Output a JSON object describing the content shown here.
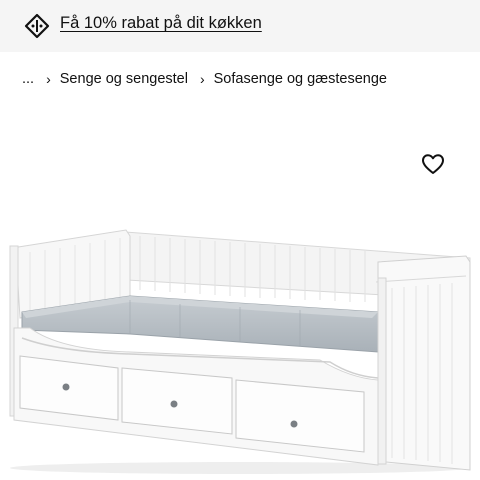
{
  "promo": {
    "text": "Få 10% rabat på dit køkken",
    "icon": "discount-tag-icon"
  },
  "breadcrumb": {
    "ellipsis": "...",
    "items": [
      {
        "label": "Senge og sengestel"
      },
      {
        "label": "Sofasenge og gæstesenge"
      }
    ],
    "separator_icon": "chevron-right-icon"
  },
  "product": {
    "favorite_icon": "heart-icon",
    "colors": {
      "frame": "#ffffff",
      "mattress": "#b9c0c6",
      "promo_background": "#f5f5f5"
    }
  }
}
